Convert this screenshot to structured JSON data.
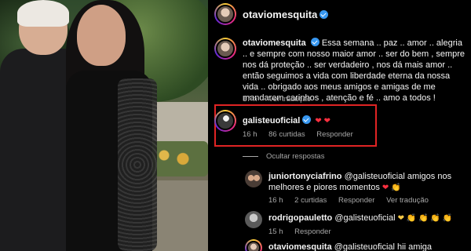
{
  "post": {
    "author": "otaviomesquita",
    "author_verified": true
  },
  "caption": {
    "username": "otaviomesquita",
    "text": "Essa semana .. paz .. amor .. alegria .. e sempre com nosso maior amor .. ser do bem , sempre nos dá proteção .. ser verdadeiro , nos dá mais amor .. então seguimos a vida com liberdade eterna da nossa vida .. obrigado aos meus amigos e amigas de me mandarem carinhos , atenção e fé .. amo a todos !",
    "time": "17 h",
    "see_translation": "Ver tradução"
  },
  "highlighted_comment": {
    "username": "galisteuoficial",
    "verified": true,
    "text": "❤ ❤",
    "time": "16 h",
    "likes": "86 curtidas",
    "reply": "Responder",
    "highlight_color": "#e02424"
  },
  "hide_replies": "Ocultar respostas",
  "replies": [
    {
      "username": "juniortonyciafrino",
      "text": "@galisteuoficial amigos nos melhores e piores momentos",
      "emojis": "❤ 👏",
      "time": "16 h",
      "likes": "2 curtidas",
      "reply": "Responder",
      "see_translation": "Ver tradução"
    },
    {
      "username": "rodrigopauletto",
      "text": "@galisteuoficial",
      "emojis": "❤ 👏 👏 👏 👏",
      "time": "15 h",
      "reply": "Responder"
    },
    {
      "username": "otaviomesquita",
      "text": "@galisteuoficial hii amiga"
    }
  ],
  "colors": {
    "background": "#000000",
    "verified_badge": "#3797f0",
    "heart": "#ff3040",
    "muted_text": "#a8a8a8"
  }
}
